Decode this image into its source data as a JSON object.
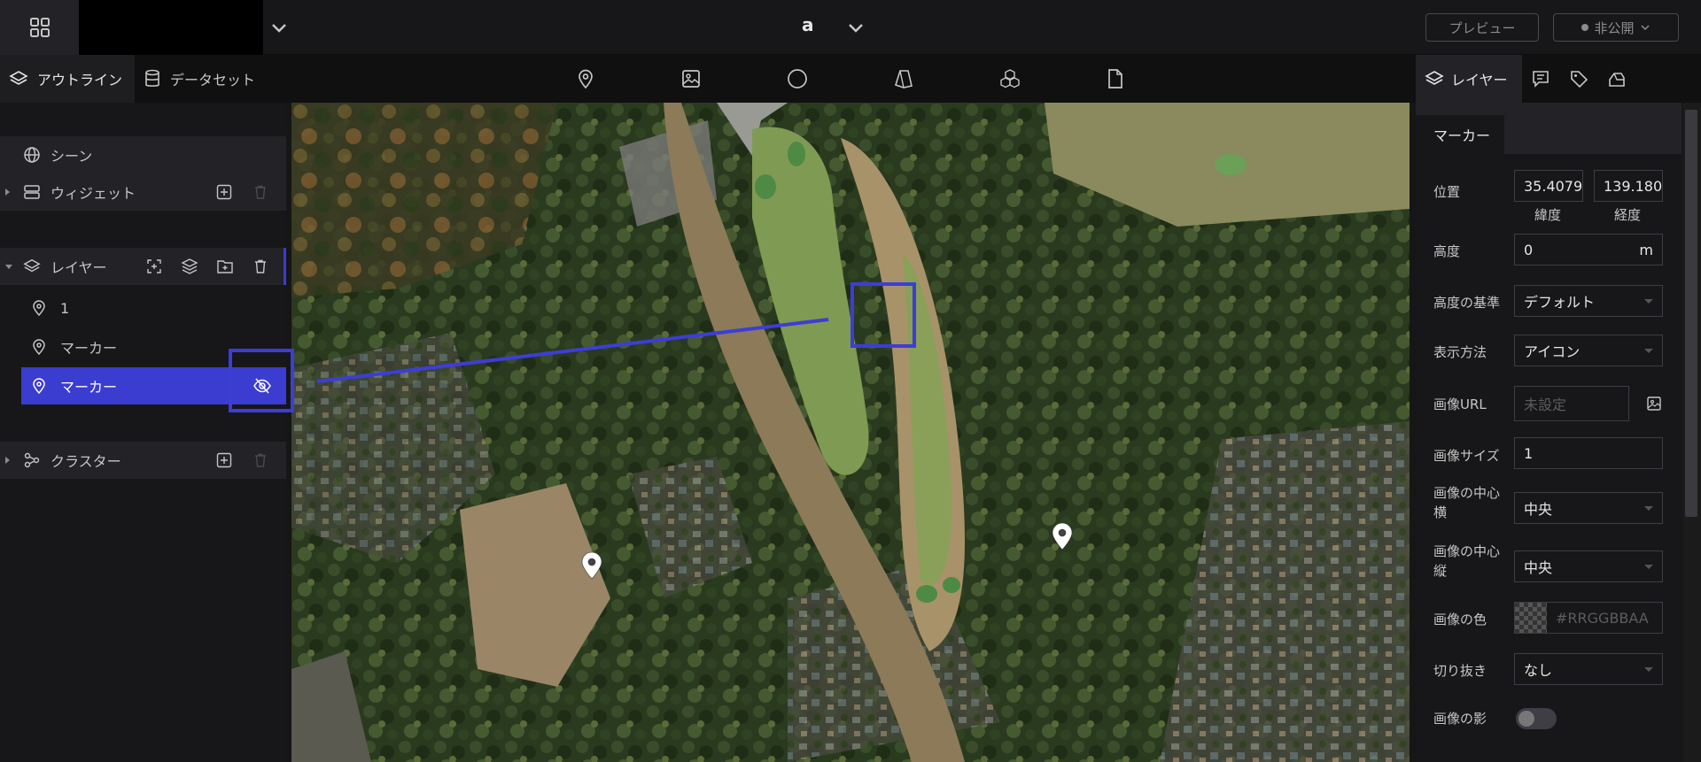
{
  "header": {
    "scene_name": "a",
    "preview_label": "プレビュー",
    "publish_label": "非公開"
  },
  "left_panel": {
    "tabs": [
      {
        "label": "アウトライン",
        "icon": "layers-icon"
      },
      {
        "label": "データセット",
        "icon": "database-icon"
      }
    ],
    "scene_label": "シーン",
    "widget_label": "ウィジェット",
    "layer_label": "レイヤー",
    "layers": [
      {
        "label": "1",
        "icon": "map-pin-icon"
      },
      {
        "label": "マーカー",
        "icon": "map-pin-icon"
      },
      {
        "label": "マーカー",
        "icon": "map-pin-icon",
        "selected": true
      }
    ],
    "cluster_label": "クラスター"
  },
  "toolbar": {
    "tools": [
      "map-pin-icon",
      "image-icon",
      "circle-icon",
      "polygon-icon",
      "cubes-icon",
      "file-icon"
    ]
  },
  "right_panel": {
    "tab_label": "レイヤー",
    "section_tab": "マーカー",
    "properties": {
      "position_label": "位置",
      "latitude_value": "35.4079",
      "latitude_label": "緯度",
      "longitude_value": "139.180",
      "longitude_label": "経度",
      "height_label": "高度",
      "height_value": "0",
      "height_unit": "m",
      "height_ref_label": "高度の基準",
      "height_ref_value": "デフォルト",
      "display_label": "表示方法",
      "display_value": "アイコン",
      "image_url_label": "画像URL",
      "image_url_placeholder": "未設定",
      "image_size_label": "画像サイズ",
      "image_size_value": "1",
      "center_x_label": "画像の中心横",
      "center_x_value": "中央",
      "center_y_label": "画像の中心縦",
      "center_y_value": "中央",
      "color_label": "画像の色",
      "color_placeholder": "#RRGGBBAA",
      "crop_label": "切り抜き",
      "crop_value": "なし",
      "shadow_label": "画像の影"
    }
  },
  "colors": {
    "accent": "#3b3cd0",
    "highlight": "#3d3dd6"
  }
}
